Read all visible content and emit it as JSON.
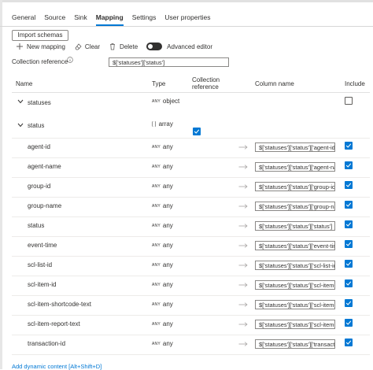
{
  "tabs": [
    {
      "label": "General"
    },
    {
      "label": "Source"
    },
    {
      "label": "Sink"
    },
    {
      "label": "Mapping",
      "active": true
    },
    {
      "label": "Settings"
    },
    {
      "label": "User properties"
    }
  ],
  "toolbar": {
    "import_schemas": "Import schemas",
    "new_mapping": "New mapping",
    "clear": "Clear",
    "delete": "Delete",
    "advanced_editor": "Advanced editor"
  },
  "collection_reference": {
    "label": "Collection reference",
    "value": "$['statuses']['status']"
  },
  "table": {
    "headers": {
      "name": "Name",
      "type": "Type",
      "collection_reference": "Collection reference",
      "column_name": "Column name",
      "include": "Include"
    },
    "parents": [
      {
        "name": "statuses",
        "type_tag": "ANY",
        "type": "object",
        "include": false
      },
      {
        "name": "status",
        "type_tag": "[ ]",
        "type": "array",
        "collection_reference": true
      }
    ],
    "rows": [
      {
        "name": "agent-id",
        "type_tag": "ANY",
        "type": "any",
        "column": "$['statuses']['status']['agent-id']",
        "include": true
      },
      {
        "name": "agent-name",
        "type_tag": "ANY",
        "type": "any",
        "column": "$['statuses']['status']['agent-name']",
        "include": true
      },
      {
        "name": "group-id",
        "type_tag": "ANY",
        "type": "any",
        "column": "$['statuses']['status']['group-id']",
        "include": true
      },
      {
        "name": "group-name",
        "type_tag": "ANY",
        "type": "any",
        "column": "$['statuses']['status']['group-name']",
        "include": true
      },
      {
        "name": "status",
        "type_tag": "ANY",
        "type": "any",
        "column": "$['statuses']['status']['status']",
        "include": true
      },
      {
        "name": "event-time",
        "type_tag": "ANY",
        "type": "any",
        "column": "$['statuses']['status']['event-time']",
        "include": true
      },
      {
        "name": "scl-list-id",
        "type_tag": "ANY",
        "type": "any",
        "column": "$['statuses']['status']['scl-list-id']",
        "include": true
      },
      {
        "name": "scl-item-id",
        "type_tag": "ANY",
        "type": "any",
        "column": "$['statuses']['status']['scl-item-id']",
        "include": true
      },
      {
        "name": "scl-item-shortcode-text",
        "type_tag": "ANY",
        "type": "any",
        "column": "$['statuses']['status']['scl-item-shortcode-text']",
        "include": true
      },
      {
        "name": "scl-item-report-text",
        "type_tag": "ANY",
        "type": "any",
        "column": "$['statuses']['status']['scl-item-report-text']",
        "include": true
      },
      {
        "name": "transaction-id",
        "type_tag": "ANY",
        "type": "any",
        "column": "$['statuses']['status']['transaction-id']",
        "include": true
      }
    ]
  },
  "footer": {
    "add_dynamic": "Add dynamic content [Alt+Shift+D]"
  },
  "colors": {
    "accent": "#0078d4",
    "text": "#323130"
  }
}
